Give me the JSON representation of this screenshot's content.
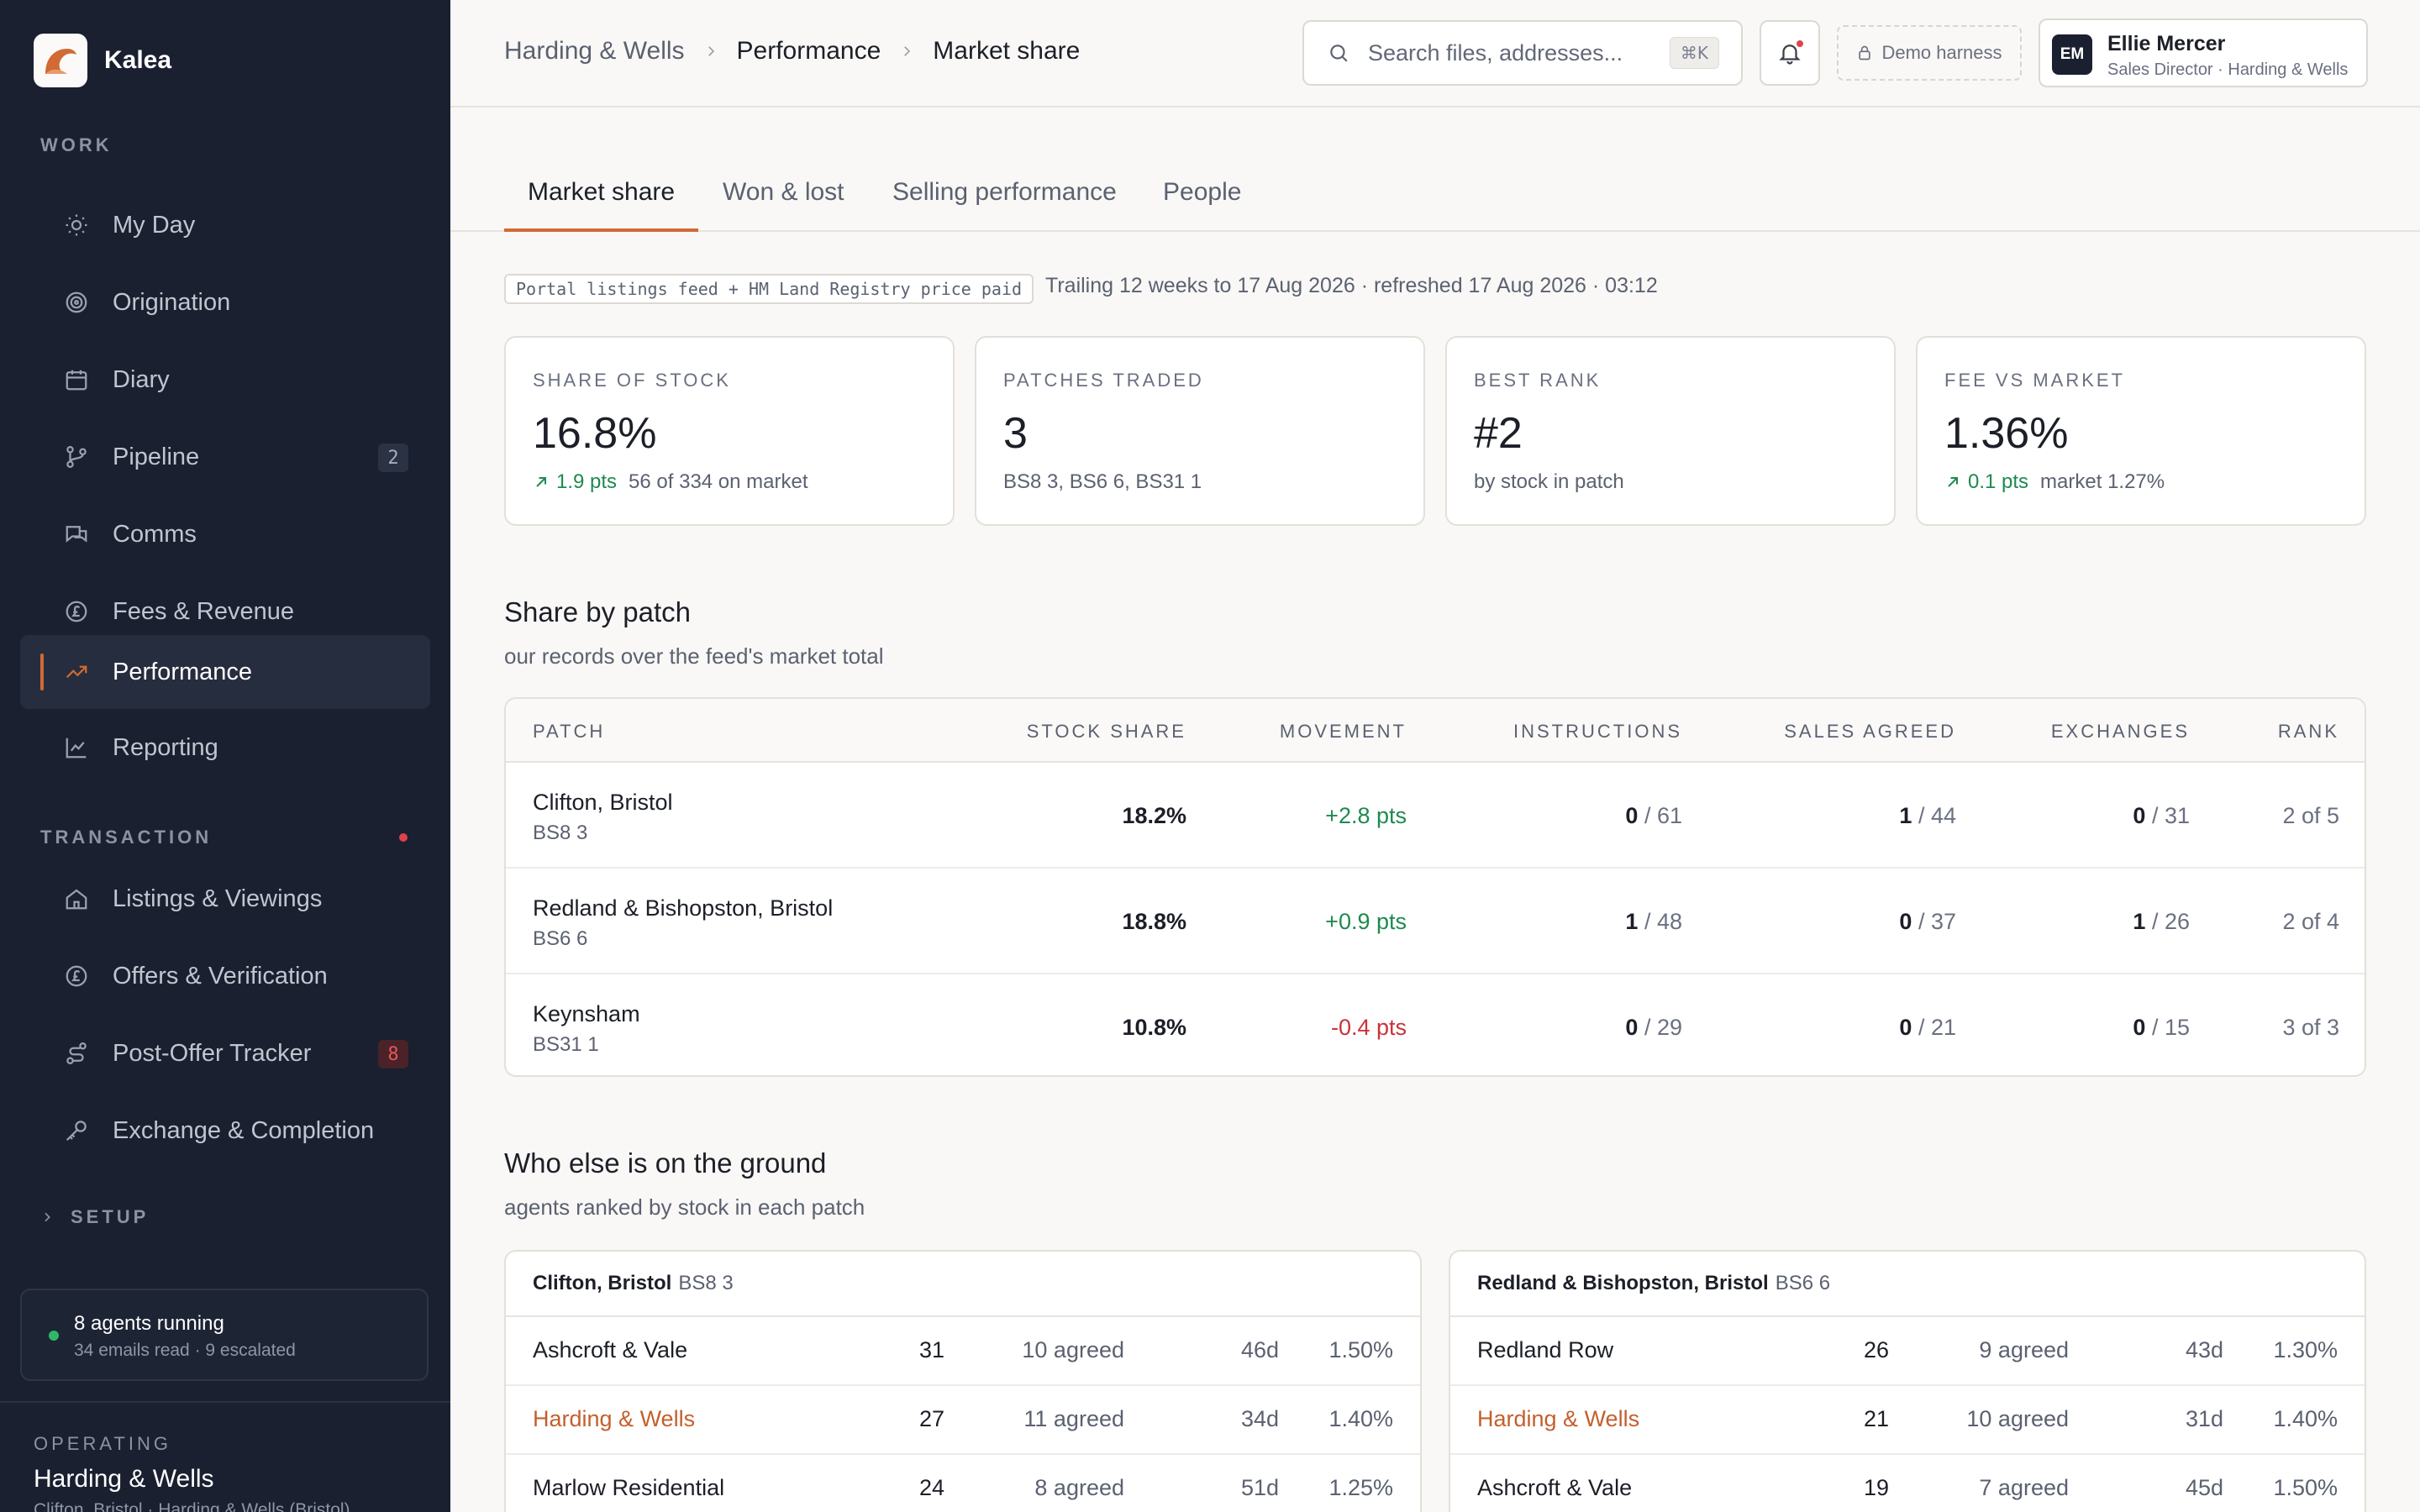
{
  "app": {
    "name": "Kalea"
  },
  "sidebar": {
    "work_label": "WORK",
    "work_items": [
      {
        "label": "My Day",
        "icon": "sun-icon"
      },
      {
        "label": "Origination",
        "icon": "target-icon"
      },
      {
        "label": "Diary",
        "icon": "calendar-icon"
      },
      {
        "label": "Pipeline",
        "icon": "branch-icon",
        "badge": "2"
      },
      {
        "label": "Comms",
        "icon": "chat-icon"
      },
      {
        "label": "Fees & Revenue",
        "icon": "pound-icon"
      },
      {
        "label": "Performance",
        "icon": "trend-up-icon",
        "active": true
      },
      {
        "label": "Reporting",
        "icon": "line-chart-icon"
      }
    ],
    "transaction_label": "TRANSACTION",
    "transaction_items": [
      {
        "label": "Listings & Viewings",
        "icon": "home-icon"
      },
      {
        "label": "Offers & Verification",
        "icon": "pound-icon"
      },
      {
        "label": "Post-Offer Tracker",
        "icon": "route-icon",
        "badge": "8"
      },
      {
        "label": "Exchange & Completion",
        "icon": "key-icon"
      }
    ],
    "setup_label": "SETUP",
    "agents": {
      "title": "8 agents running",
      "sub": "34 emails read · 9 escalated"
    },
    "operating": {
      "label": "OPERATING",
      "name": "Harding & Wells",
      "sub": "Clifton, Bristol · Harding & Wells (Bristol)"
    }
  },
  "header": {
    "breadcrumb": [
      "Harding & Wells",
      "Performance",
      "Market share"
    ],
    "search_placeholder": "Search files, addresses...",
    "search_shortcut": "⌘K",
    "demo_label": "Demo harness",
    "user": {
      "initials": "EM",
      "name": "Ellie Mercer",
      "role": "Sales Director · Harding & Wells"
    }
  },
  "tabs": [
    "Market share",
    "Won & lost",
    "Selling performance",
    "People"
  ],
  "source": {
    "chip": "Portal listings feed + HM Land Registry price paid",
    "note": "Trailing 12 weeks to 17 Aug 2026 · refreshed 17 Aug 2026 · 03:12"
  },
  "kpis": [
    {
      "label": "SHARE OF STOCK",
      "value": "16.8%",
      "delta": "1.9 pts",
      "sub": "56 of 334 on market"
    },
    {
      "label": "PATCHES TRADED",
      "value": "3",
      "sub": "BS8 3, BS6 6, BS31 1"
    },
    {
      "label": "BEST RANK",
      "value": "#2",
      "sub": "by stock in patch"
    },
    {
      "label": "FEE VS MARKET",
      "value": "1.36%",
      "delta": "0.1 pts",
      "sub": "market 1.27%"
    }
  ],
  "share": {
    "title": "Share by patch",
    "subtitle": "our records over the feed's market total",
    "columns": [
      "PATCH",
      "STOCK SHARE",
      "MOVEMENT",
      "INSTRUCTIONS",
      "SALES AGREED",
      "EXCHANGES",
      "RANK"
    ],
    "rows": [
      {
        "name": "Clifton, Bristol",
        "code": "BS8 3",
        "share": "18.2%",
        "movement": "+2.8 pts",
        "inst_n": "0",
        "inst_t": " / 61",
        "sa_n": "1",
        "sa_t": " / 44",
        "ex_n": "0",
        "ex_t": " / 31",
        "rank": "2 of 5"
      },
      {
        "name": "Redland & Bishopston, Bristol",
        "code": "BS6 6",
        "share": "18.8%",
        "movement": "+0.9 pts",
        "inst_n": "1",
        "inst_t": " / 48",
        "sa_n": "0",
        "sa_t": " / 37",
        "ex_n": "1",
        "ex_t": " / 26",
        "rank": "2 of 4"
      },
      {
        "name": "Keynsham",
        "code": "BS31 1",
        "share": "10.8%",
        "movement": "-0.4 pts",
        "inst_n": "0",
        "inst_t": " / 29",
        "sa_n": "0",
        "sa_t": " / 21",
        "ex_n": "0",
        "ex_t": " / 15",
        "rank": "3 of 3"
      }
    ]
  },
  "competitors": {
    "title": "Who else is on the ground",
    "subtitle": "agents ranked by stock in each patch",
    "panels": [
      {
        "name": "Clifton, Bristol",
        "code": "BS8 3",
        "rows": [
          {
            "agent": "Ashcroft & Vale",
            "stock": "31",
            "agreed": "10 agreed",
            "days": "46d",
            "fee": "1.50%"
          },
          {
            "agent": "Harding & Wells",
            "stock": "27",
            "agreed": "11 agreed",
            "days": "34d",
            "fee": "1.40%"
          },
          {
            "agent": "Marlow Residential",
            "stock": "24",
            "agreed": "8 agreed",
            "days": "51d",
            "fee": "1.25%"
          }
        ]
      },
      {
        "name": "Redland & Bishopston, Bristol",
        "code": "BS6 6",
        "rows": [
          {
            "agent": "Redland Row",
            "stock": "26",
            "agreed": "9 agreed",
            "days": "43d",
            "fee": "1.30%"
          },
          {
            "agent": "Harding & Wells",
            "stock": "21",
            "agreed": "10 agreed",
            "days": "31d",
            "fee": "1.40%"
          },
          {
            "agent": "Ashcroft & Vale",
            "stock": "19",
            "agreed": "7 agreed",
            "days": "45d",
            "fee": "1.50%"
          }
        ]
      }
    ]
  },
  "colors": {
    "accent": "#d16a35",
    "sidebar_bg": "#1a2030",
    "positive": "#1e8a4f",
    "negative": "#c8333a"
  }
}
